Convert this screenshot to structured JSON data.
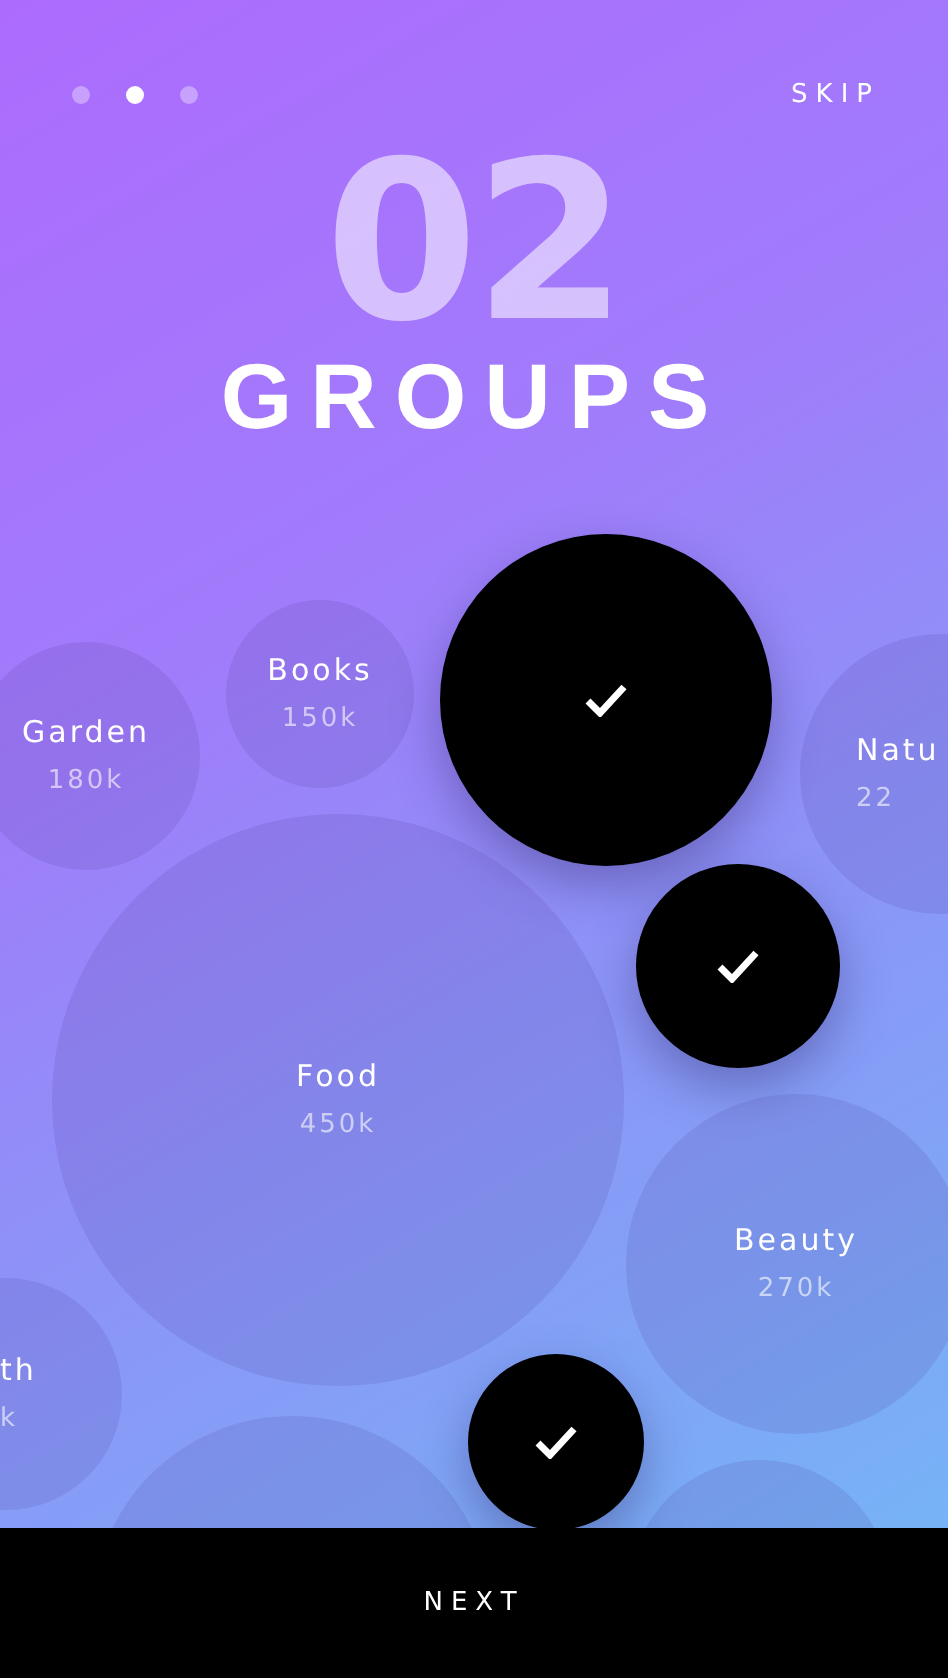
{
  "pager": {
    "dots": [
      {
        "selected": false
      },
      {
        "selected": true
      },
      {
        "selected": false
      }
    ]
  },
  "skip": "SKIP",
  "step_number": "02",
  "title": "GROUPS",
  "bubbles": [
    {
      "name": "Garden",
      "count": "180k",
      "selected": false
    },
    {
      "name": "Books",
      "count": "150k",
      "selected": false
    },
    {
      "selected": true
    },
    {
      "name": "Natu",
      "count": "22",
      "selected": false
    },
    {
      "selected": true
    },
    {
      "name": "Food",
      "count": "450k",
      "selected": false
    },
    {
      "name": "Beauty",
      "count": "270k",
      "selected": false
    },
    {
      "name": "th",
      "count": "k",
      "selected": false
    },
    {
      "selected": true
    },
    {
      "selected": false
    },
    {
      "selected": false
    }
  ],
  "next": "NEXT"
}
